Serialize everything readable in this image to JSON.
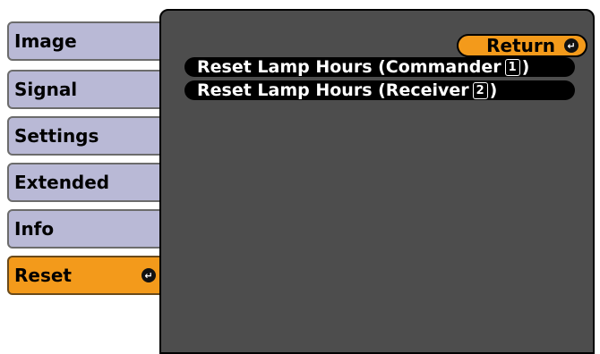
{
  "menu": {
    "items": [
      {
        "label": "Image"
      },
      {
        "label": "Signal"
      },
      {
        "label": "Settings"
      },
      {
        "label": "Extended"
      },
      {
        "label": "Info"
      },
      {
        "label": "Reset",
        "active": true
      }
    ],
    "enter_glyph": "↵"
  },
  "panel": {
    "return_label": "Return",
    "rows": [
      {
        "label": "Reset Lamp Hours (Commander ",
        "num": "1",
        "suffix": ")"
      },
      {
        "label": "Reset Lamp Hours (Receiver ",
        "num": "2",
        "suffix": " )"
      }
    ]
  },
  "colors": {
    "menu_bg": "#b9b9d6",
    "active_bg": "#f39a1b",
    "panel_bg": "#4d4d4d"
  }
}
